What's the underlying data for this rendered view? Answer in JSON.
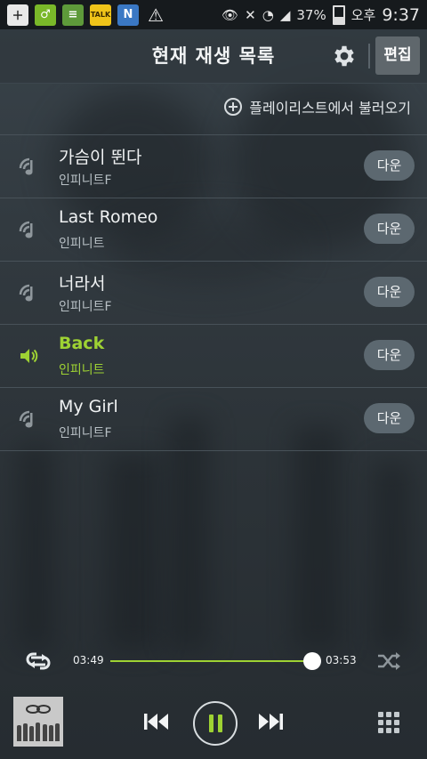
{
  "status_bar": {
    "battery_percent": "37%",
    "ampm": "오후",
    "time": "9:37",
    "notification_icons": [
      "plus-icon",
      "fitness-icon",
      "stack-icon",
      "talk-icon",
      "n-icon",
      "warning-icon"
    ]
  },
  "header": {
    "title": "현재 재생 목록",
    "edit_label": "편집"
  },
  "load_playlist_label": "플레이리스트에서 불러오기",
  "playlist": {
    "download_label": "다운",
    "items": [
      {
        "title": "가슴이 뛴다",
        "artist": "인피니트F",
        "active": false
      },
      {
        "title": "Last Romeo",
        "artist": "인피니트",
        "active": false
      },
      {
        "title": "너라서",
        "artist": "인피니트F",
        "active": false
      },
      {
        "title": "Back",
        "artist": "인피니트",
        "active": true
      },
      {
        "title": "My Girl",
        "artist": "인피니트F",
        "active": false
      }
    ]
  },
  "player": {
    "current_time": "03:49",
    "total_time": "03:53",
    "progress_fraction": 0.98,
    "accent_color": "#9ed233"
  }
}
